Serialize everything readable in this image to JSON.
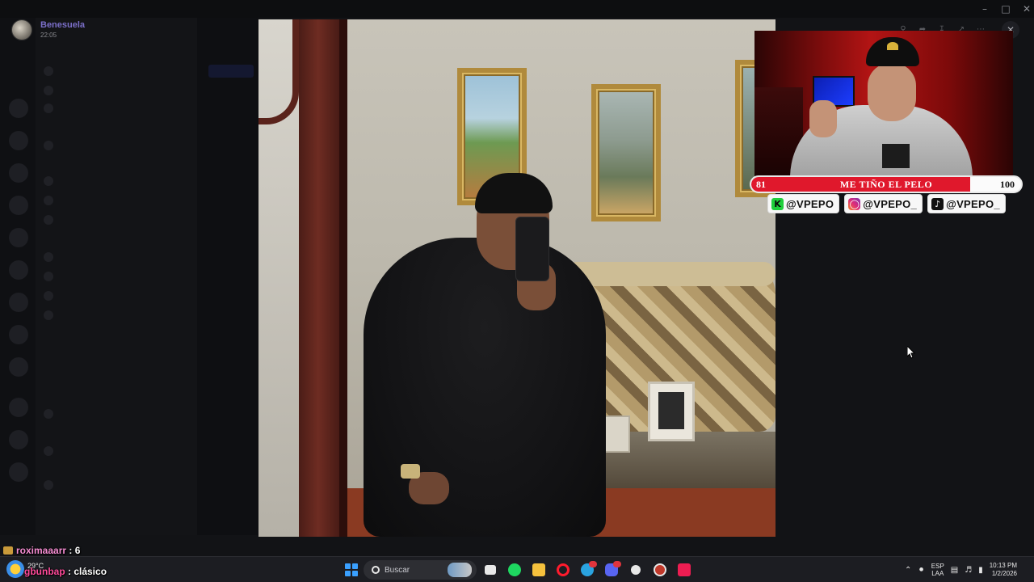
{
  "notification": {
    "username": "Benesuela",
    "time": "22:05"
  },
  "goal": {
    "title": "ME TIÑO EL PELO",
    "current": "81",
    "target": "100",
    "progress_fraction": 0.81,
    "fill_color": "#e0182c"
  },
  "socials": [
    {
      "icon": "kick-icon",
      "handle": "@VPEPO"
    },
    {
      "icon": "instagram-icon",
      "handle": "@VPEPO_"
    },
    {
      "icon": "tiktok-icon",
      "handle": "@VPEPO_"
    }
  ],
  "chat": [
    {
      "user": "roximaaarr",
      "message": "6"
    },
    {
      "user": "gbunbap",
      "message": "clásico"
    }
  ],
  "taskbar": {
    "temperature": "29°C",
    "search_label": "Buscar",
    "language_1": "ESP",
    "language_2": "LAA",
    "time": "10:13 PM",
    "date": "1/2/2026"
  },
  "colors": {
    "accent_purple": "#7b6fc9",
    "chat_user": "#f58cd2"
  }
}
